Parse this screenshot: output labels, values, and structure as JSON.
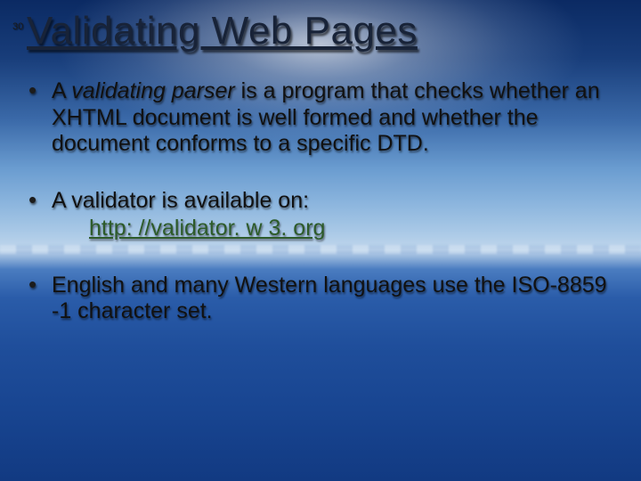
{
  "pageNumber": "30",
  "title": "Validating Web Pages",
  "bullets": {
    "b1": {
      "lead": "A ",
      "em": "validating parser",
      "rest": " is a program that checks whether an XHTML document is well formed and whether the document conforms to a specific DTD."
    },
    "b2": {
      "text": "A validator is available on:",
      "link": "http: //validator. w 3. org"
    },
    "b3": {
      "text": "English and many Western languages use the ISO-8859 -1 character set."
    }
  }
}
